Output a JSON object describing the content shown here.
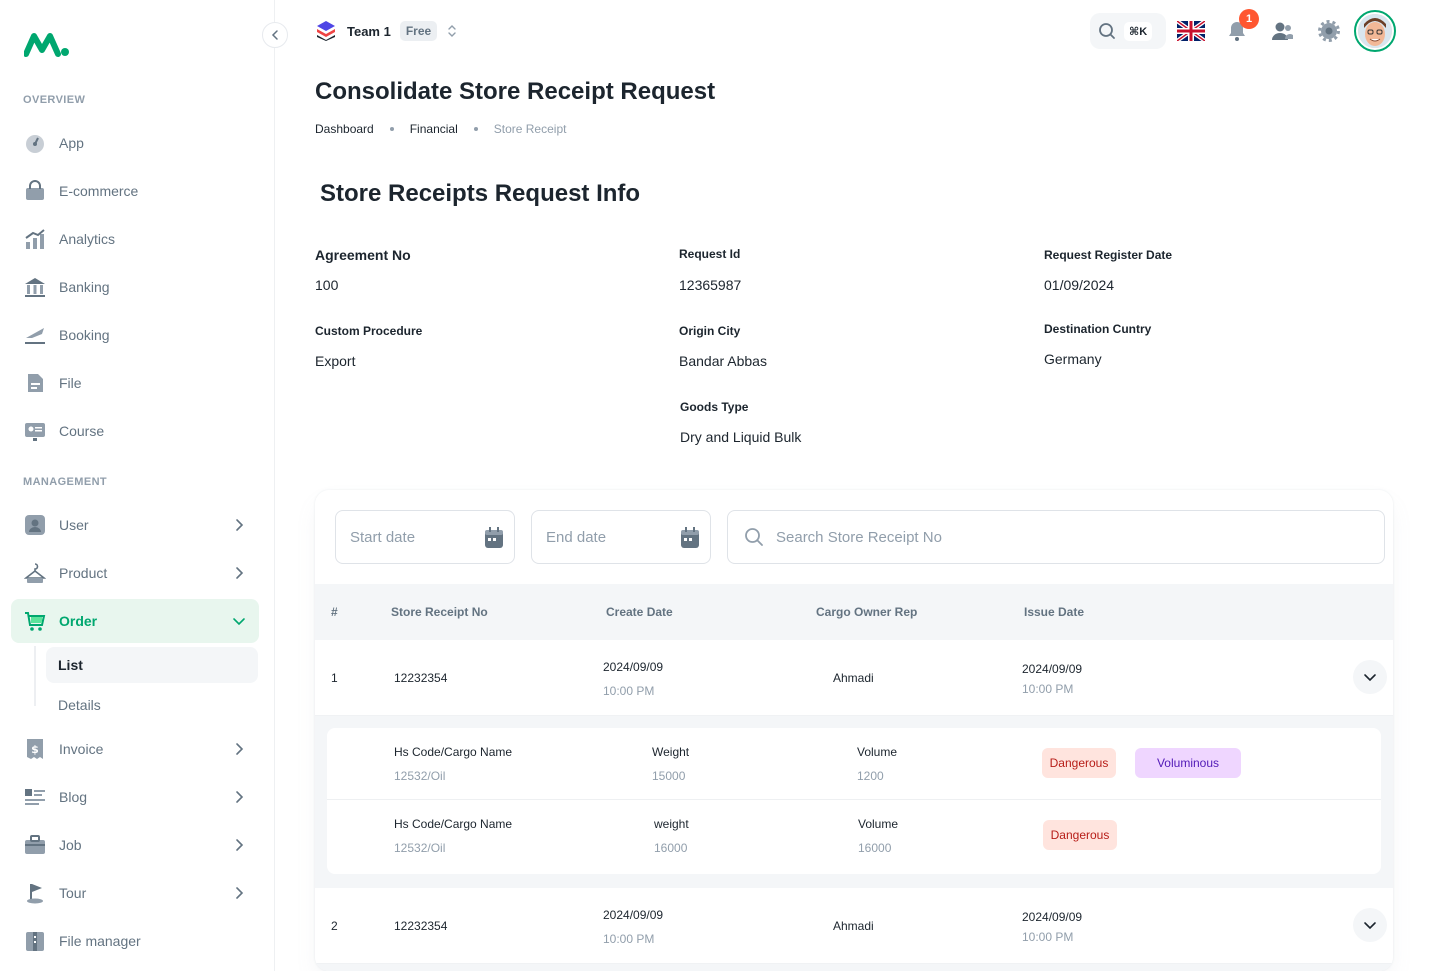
{
  "sidebar": {
    "overview_title": "OVERVIEW",
    "management_title": "MANAGEMENT",
    "overview_items": [
      {
        "label": "App",
        "icon": "dashboard-icon"
      },
      {
        "label": "E-commerce",
        "icon": "shopping-bag-icon"
      },
      {
        "label": "Analytics",
        "icon": "analytics-icon"
      },
      {
        "label": "Banking",
        "icon": "bank-icon"
      },
      {
        "label": "Booking",
        "icon": "airplane-icon"
      },
      {
        "label": "File",
        "icon": "file-icon"
      },
      {
        "label": "Course",
        "icon": "course-icon"
      }
    ],
    "management_items": [
      {
        "label": "User",
        "icon": "user-icon"
      },
      {
        "label": "Product",
        "icon": "product-icon"
      },
      {
        "label": "Order",
        "icon": "cart-icon"
      },
      {
        "label": "Invoice",
        "icon": "invoice-icon"
      },
      {
        "label": "Blog",
        "icon": "blog-icon"
      },
      {
        "label": "Job",
        "icon": "briefcase-icon"
      },
      {
        "label": "Tour",
        "icon": "flag-icon"
      },
      {
        "label": "File manager",
        "icon": "folder-icon"
      }
    ],
    "order_sub": [
      "List",
      "Details"
    ]
  },
  "topbar": {
    "team_name": "Team 1",
    "plan": "Free",
    "shortcut": "⌘K",
    "notifications": "1"
  },
  "page": {
    "title": "Consolidate Store Receipt Request",
    "breadcrumbs": [
      "Dashboard",
      "Financial",
      "Store Receipt"
    ],
    "info_title": "Store Receipts Request Info"
  },
  "info": {
    "agreement_label": "Agreement No",
    "agreement_value": "100",
    "request_id_label": "Request Id",
    "request_id_value": "12365987",
    "register_label": "Request Register Date",
    "register_value": "01/09/2024",
    "procedure_label": "Custom Procedure",
    "procedure_value": "Export",
    "origin_label": "Origin City",
    "origin_value": "Bandar Abbas",
    "destination_label": "Destination Cuntry",
    "destination_value": "Germany",
    "goods_label": "Goods Type",
    "goods_value": "Dry and Liquid Bulk"
  },
  "filters": {
    "start_placeholder": "Start date",
    "end_placeholder": "End date",
    "search_placeholder": "Search Store Receipt No"
  },
  "table": {
    "headers": [
      "#",
      "Store Receipt No",
      "Create Date",
      "Cargo Owner Rep",
      "Issue Date"
    ],
    "rows": [
      {
        "index": "1",
        "receipt_no": "12232354",
        "create_date": "2024/09/09",
        "create_time": "10:00 PM",
        "owner": "Ahmadi",
        "issue_date": "2024/09/09",
        "issue_time": "10:00 PM"
      },
      {
        "index": "2",
        "receipt_no": "12232354",
        "create_date": "2024/09/09",
        "create_time": "10:00 PM",
        "owner": "Ahmadi",
        "issue_date": "2024/09/09",
        "issue_time": "10:00 PM"
      }
    ],
    "details": [
      {
        "code_label": "Hs Code/Cargo Name",
        "code_value": "12532/Oil",
        "weight_label": "Weight",
        "weight_value": "15000",
        "volume_label": "Volume",
        "volume_value": "1200",
        "tags": [
          "Dangerous",
          "Voluminous"
        ]
      },
      {
        "code_label": "Hs Code/Cargo Name",
        "code_value": "12532/Oil",
        "weight_label": "weight",
        "weight_value": "16000",
        "volume_label": "Volume",
        "volume_value": "16000",
        "tags": [
          "Dangerous"
        ]
      }
    ]
  },
  "colors": {
    "accent": "#00a76f",
    "danger_bg": "#ffe4de",
    "danger_text": "#b71d18",
    "voluminous_bg": "#efd6ff",
    "voluminous_text": "#5119b7",
    "badge_red": "#ff5630"
  }
}
